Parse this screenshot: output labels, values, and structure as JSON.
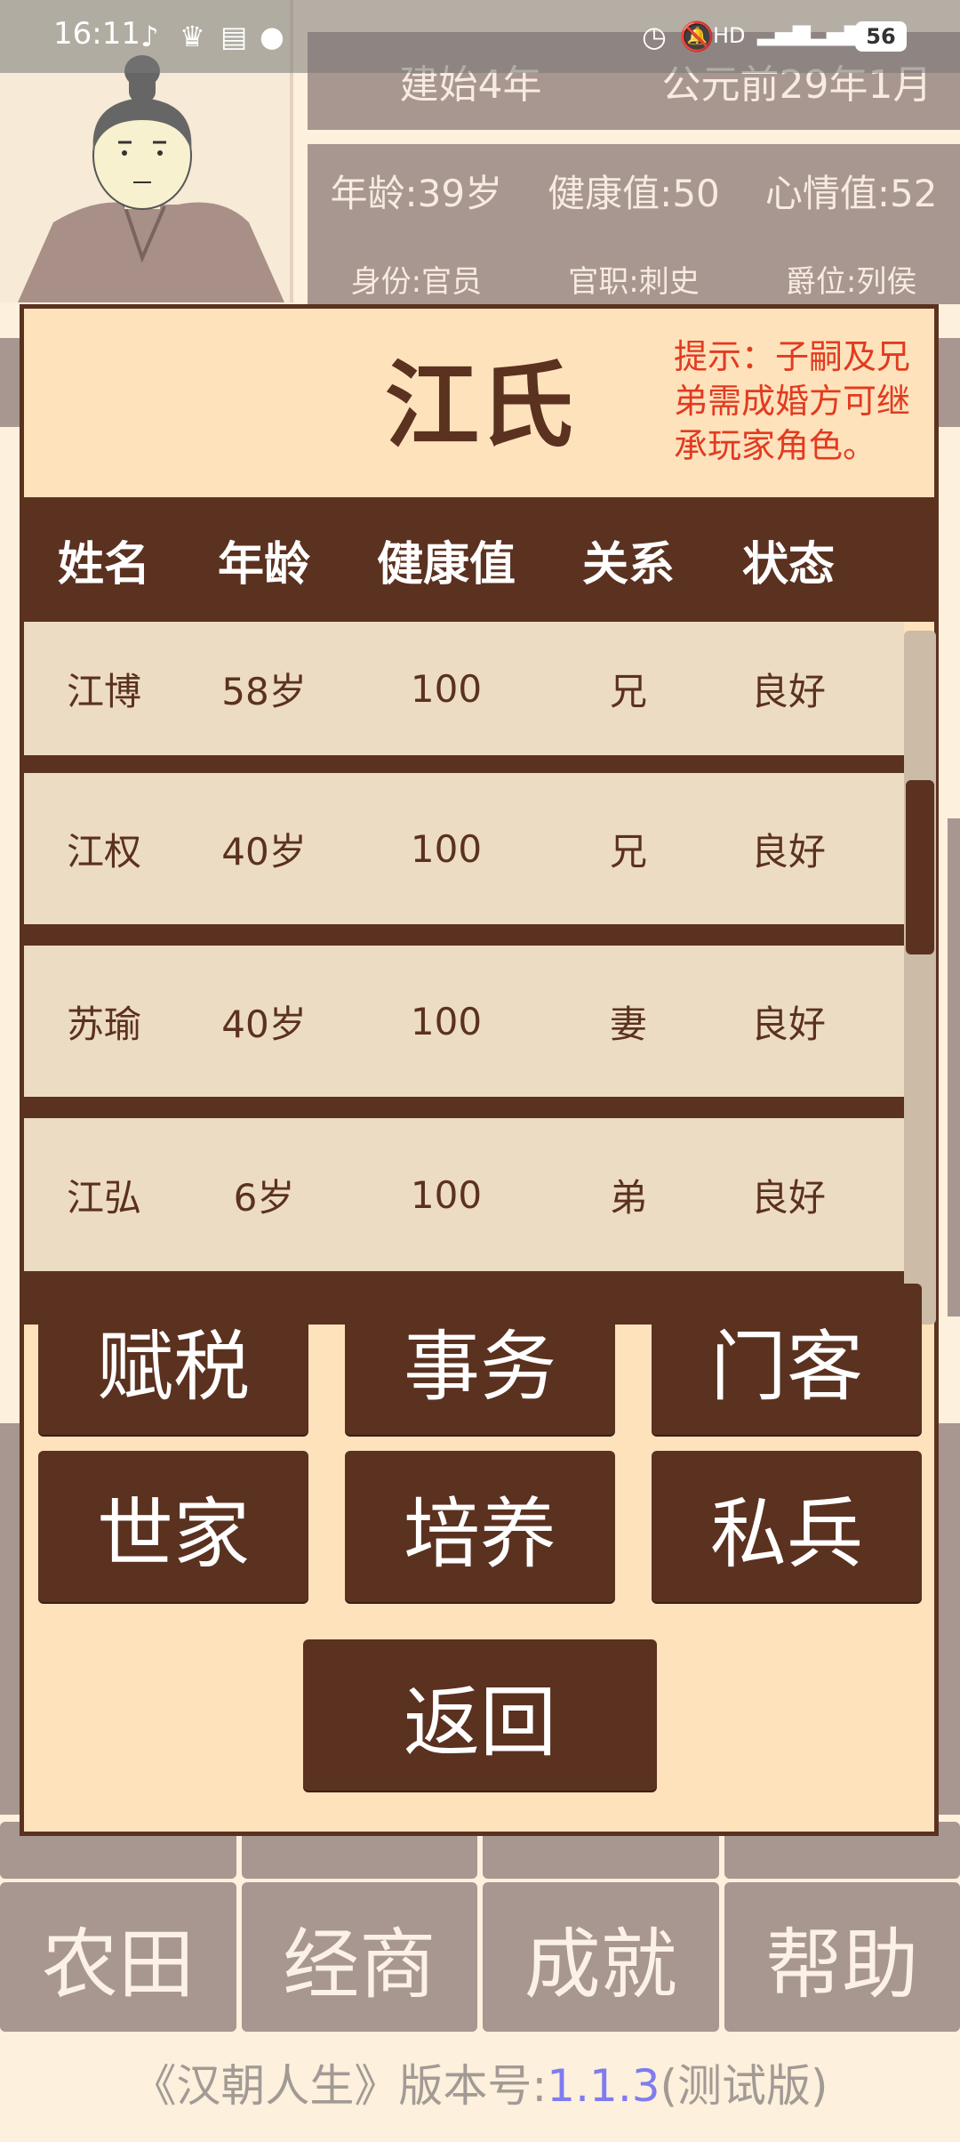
{
  "status_bar": {
    "time": "16:11",
    "battery": "56",
    "icons": [
      "music-icon",
      "crown-icon",
      "card-icon",
      "chat-icon",
      "alarm-icon",
      "mute-icon",
      "hd-icon",
      "5g-signal-icon",
      "4g-signal-icon"
    ]
  },
  "header": {
    "era": "建始4年",
    "date": "公元前29年1月",
    "age": "年龄:39岁",
    "health": "健康值:50",
    "mood": "心情值:52",
    "identity": "身份:官员",
    "office": "官职:刺史",
    "rank": "爵位:列侯"
  },
  "modal": {
    "family_name": "江氏",
    "hint": "提示：子嗣及兄弟需成婚方可继承玩家角色。",
    "columns": [
      "姓名",
      "年龄",
      "健康值",
      "关系",
      "状态"
    ],
    "rows": [
      {
        "name": "江博",
        "age": "58岁",
        "health": "100",
        "relation": "兄",
        "status": "良好"
      },
      {
        "name": "江权",
        "age": "40岁",
        "health": "100",
        "relation": "兄",
        "status": "良好"
      },
      {
        "name": "苏瑜",
        "age": "40岁",
        "health": "100",
        "relation": "妻",
        "status": "良好"
      },
      {
        "name": "江弘",
        "age": "6岁",
        "health": "100",
        "relation": "弟",
        "status": "良好"
      }
    ],
    "buttons": {
      "tax": "赋税",
      "affairs": "事务",
      "retainers": "门客",
      "clans": "世家",
      "cultivate": "培养",
      "private_army": "私兵",
      "back": "返回"
    }
  },
  "bottom_nav": [
    "农田",
    "经商",
    "成就",
    "帮助"
  ],
  "footer": {
    "prefix": "《汉朝人生》版本号:",
    "version": "1.1.3",
    "suffix": "(测试版)"
  },
  "colors": {
    "accent": "#5b3120",
    "panel": "#fde2bc",
    "row": "#eddcc4",
    "hint": "#e23b20",
    "muted": "#a89690",
    "version": "#7f7cf0"
  }
}
